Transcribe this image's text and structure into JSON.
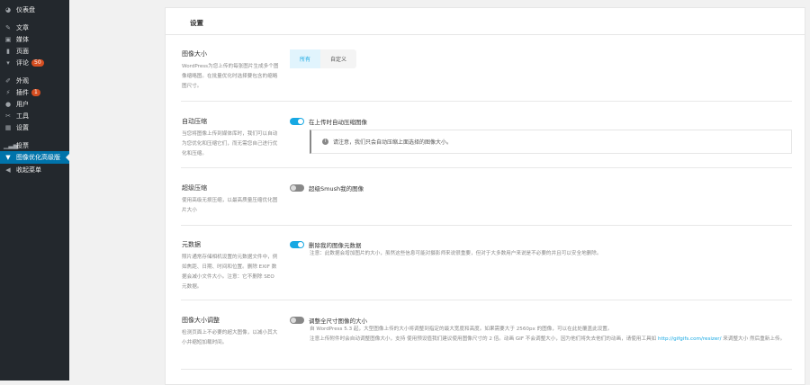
{
  "sidebar": {
    "items": [
      {
        "label": "仪表盘",
        "icon": "dashboard-icon"
      },
      {
        "label": "文章",
        "icon": "pin-icon"
      },
      {
        "label": "媒体",
        "icon": "media-icon"
      },
      {
        "label": "页面",
        "icon": "page-icon"
      },
      {
        "label": "评论",
        "icon": "comment-icon",
        "badge": "50"
      },
      {
        "label": "外观",
        "icon": "brush-icon"
      },
      {
        "label": "插件",
        "icon": "plugin-icon",
        "badge": "1"
      },
      {
        "label": "用户",
        "icon": "user-icon"
      },
      {
        "label": "工具",
        "icon": "wrench-icon"
      },
      {
        "label": "设置",
        "icon": "settings-icon"
      },
      {
        "label": "投票",
        "icon": "chart-icon"
      },
      {
        "label": "图像优化高级版",
        "icon": "smush-icon"
      },
      {
        "label": "收起菜单",
        "icon": "collapse-icon"
      }
    ]
  },
  "header": {
    "title": "设置"
  },
  "sections": {
    "sizes": {
      "title": "图像大小",
      "desc": "WordPress为您上传的每张图片生成多个图像缩略图。在批量优化时选择要包含的缩略图尺寸。",
      "opt_all": "所有",
      "opt_custom": "自定义"
    },
    "auto": {
      "title": "自动压缩",
      "desc": "当您将图像上传到媒体库时，我们可以自动为您优化和压缩它们，而无需您自己进行优化和压缩。",
      "toggle": "在上传时自动压缩图像",
      "notice": "请注意，我们只会自动压缩上面选择的图像大小。"
    },
    "super": {
      "title": "超级压缩",
      "desc": "使用高级无损压缩，以最高质量压缩优化图片大小",
      "toggle": "超级Smush我的图像"
    },
    "meta": {
      "title": "元数据",
      "desc": "照片通常存储相机设置的元数据文件中，例如焦距、日期、时间和位置。删除 EXIF 数据会减小文件大小。注意：它不删除 SEO 元数据。",
      "toggle": "删除我的图像元数据",
      "note": "注意：此数据会增加图片的大小，虽然这些信息可能对摄影师来说很重要，但对于大多数用户来说是不必要的并且可以安全地删除。"
    },
    "resize": {
      "title": "图像大小调整",
      "desc": "检测页面上不必要的超大图像，以减小其大小并缩短加载时间。",
      "toggle": "调整全尺寸图像的大小",
      "note1": "自 WordPress 5.3 起，大型图像上传的大小将调整到指定的最大宽度和高度。如果需要大于 2560px 的图像，可以在此处覆盖此设置。",
      "note2a": "注意上传附件时会自动调整图像大小，支持 使用预设值我们建议使用图像尺寸的 2 倍。动画 GIF 不会调整大小，因为他们将失去他们的动画，请使用工具如 ",
      "link": "http://gifgifs.com/resizer/",
      "note2b": " 来调整大小 然后重新上传。"
    }
  }
}
